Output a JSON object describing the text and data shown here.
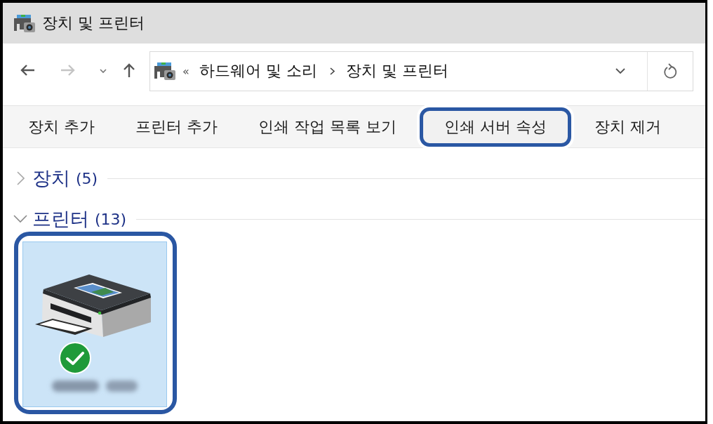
{
  "window": {
    "title": "장치 및 프린터"
  },
  "navigation": {
    "back_enabled": true,
    "forward_enabled": false
  },
  "address_bar": {
    "overflow": "«",
    "path": [
      "하드웨어 및 소리",
      "장치 및 프린터"
    ]
  },
  "toolbar": [
    {
      "label": "장치 추가",
      "highlighted": false
    },
    {
      "label": "프린터 추가",
      "highlighted": false
    },
    {
      "label": "인쇄 작업 목록 보기",
      "highlighted": false
    },
    {
      "label": "인쇄 서버 속성",
      "highlighted": true
    },
    {
      "label": "장치 제거",
      "highlighted": false
    }
  ],
  "groups": [
    {
      "title": "장치",
      "count": "(5)",
      "expanded": false
    },
    {
      "title": "프린터",
      "count": "(13)",
      "expanded": true,
      "items": [
        {
          "kind": "printer",
          "selected": true,
          "highlighted": true,
          "is_default": true,
          "label_blurred": true
        }
      ]
    }
  ]
}
